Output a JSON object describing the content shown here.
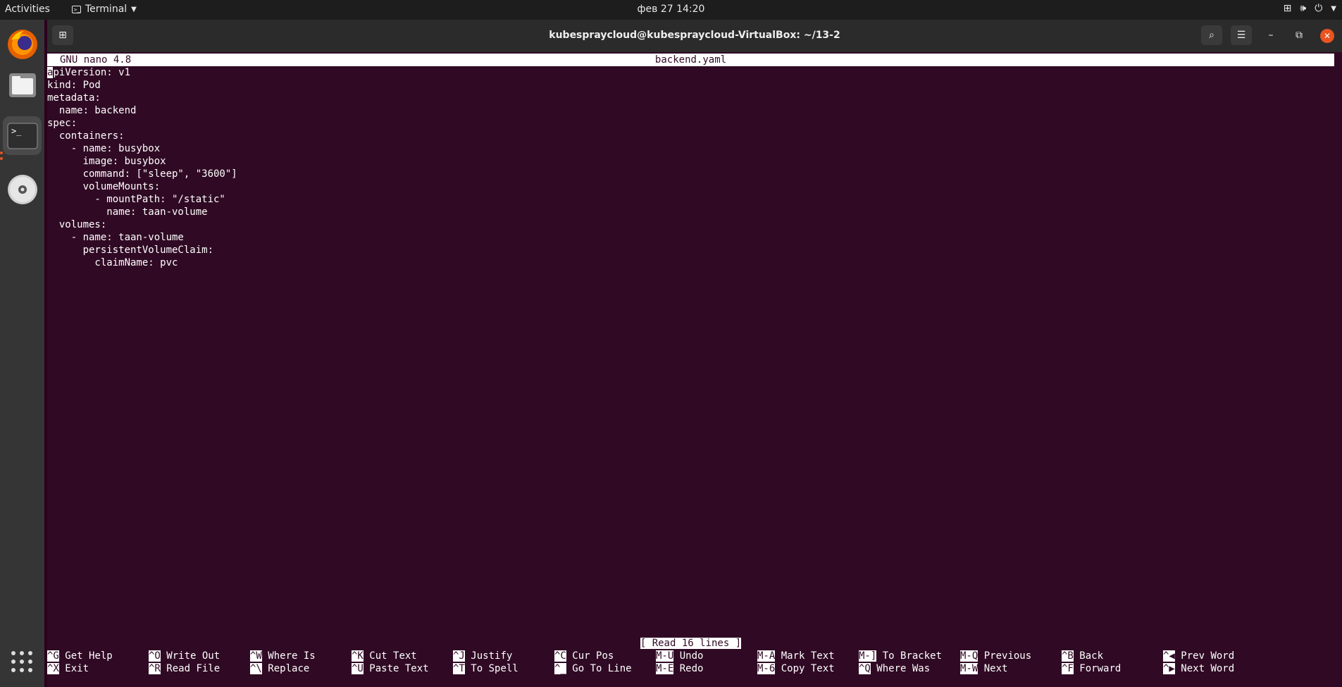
{
  "topbar": {
    "activities": "Activities",
    "app_name": "Terminal",
    "clock": "фев 27  14:20"
  },
  "dock": {
    "items": [
      "firefox-icon",
      "files-icon",
      "terminal-icon",
      "disc-icon"
    ],
    "accent": "#e95420"
  },
  "window": {
    "title": "kubespraycloud@kubespraycloud-VirtualBox: ~/13-2"
  },
  "nano": {
    "version": "GNU nano 4.8",
    "filename": "backend.yaml",
    "cursor_char": "a",
    "first_line_rest": "piVersion: v1",
    "lines": [
      "kind: Pod",
      "metadata:",
      "  name: backend",
      "spec:",
      "  containers:",
      "    - name: busybox",
      "      image: busybox",
      "      command: [\"sleep\", \"3600\"]",
      "      volumeMounts:",
      "        - mountPath: \"/static\"",
      "          name: taan-volume",
      "  volumes:",
      "    - name: taan-volume",
      "      persistentVolumeClaim:",
      "        claimName: pvc"
    ],
    "status": "[ Read 16 lines ]",
    "shortcuts_row1": [
      {
        "key": "^G",
        "label": "Get Help"
      },
      {
        "key": "^O",
        "label": "Write Out"
      },
      {
        "key": "^W",
        "label": "Where Is"
      },
      {
        "key": "^K",
        "label": "Cut Text"
      },
      {
        "key": "^J",
        "label": "Justify"
      },
      {
        "key": "^C",
        "label": "Cur Pos"
      },
      {
        "key": "M-U",
        "label": "Undo"
      },
      {
        "key": "M-A",
        "label": "Mark Text"
      },
      {
        "key": "M-]",
        "label": "To Bracket"
      },
      {
        "key": "M-Q",
        "label": "Previous"
      },
      {
        "key": "^B",
        "label": "Back"
      },
      {
        "key": "^◀",
        "label": "Prev Word"
      }
    ],
    "shortcuts_row2": [
      {
        "key": "^X",
        "label": "Exit"
      },
      {
        "key": "^R",
        "label": "Read File"
      },
      {
        "key": "^\\",
        "label": "Replace"
      },
      {
        "key": "^U",
        "label": "Paste Text"
      },
      {
        "key": "^T",
        "label": "To Spell"
      },
      {
        "key": "^_",
        "label": "Go To Line"
      },
      {
        "key": "M-E",
        "label": "Redo"
      },
      {
        "key": "M-6",
        "label": "Copy Text"
      },
      {
        "key": "^Q",
        "label": "Where Was"
      },
      {
        "key": "M-W",
        "label": "Next"
      },
      {
        "key": "^F",
        "label": "Forward"
      },
      {
        "key": "^▶",
        "label": "Next Word"
      }
    ]
  }
}
